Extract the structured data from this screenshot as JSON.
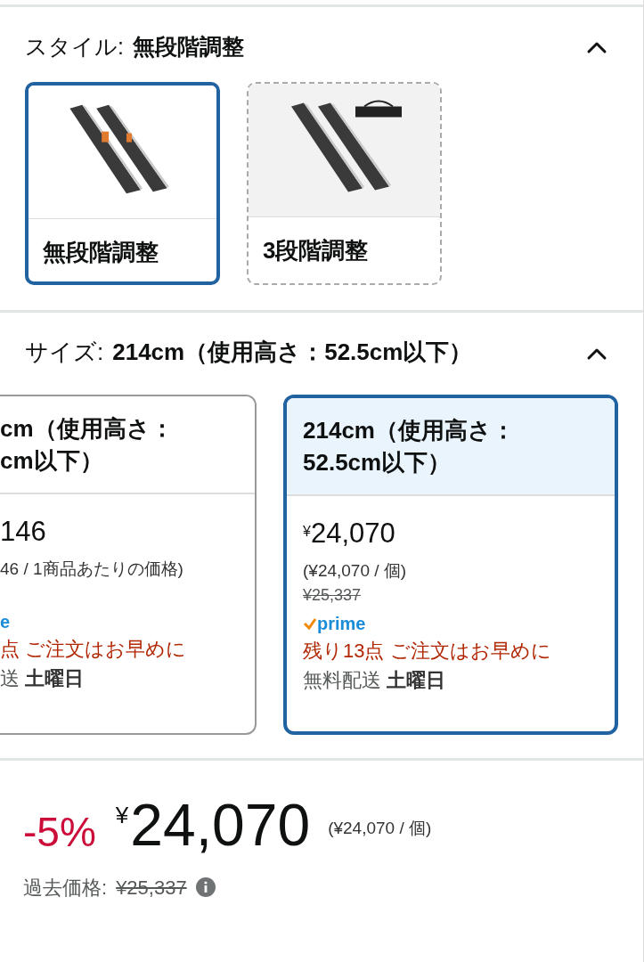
{
  "style_section": {
    "label": "スタイル:",
    "value": "無段階調整",
    "expanded": true,
    "options": [
      {
        "label": "無段階調整",
        "selected": true,
        "kind": "picture"
      },
      {
        "label": "3段階調整",
        "selected": false,
        "kind": "picture"
      }
    ]
  },
  "size_section": {
    "label": "サイズ:",
    "value": "214cm（使用高さ：52.5cm以下）",
    "expanded": true,
    "options": [
      {
        "title": "cm（使用高さ：\ncm以下）",
        "selected": false,
        "price": "146",
        "unit_price": "46 / 1商品あたりの価格)",
        "prime": "e",
        "stock": "点 ご注文はお早めに",
        "delivery": "送",
        "delivery_day": "土曜日"
      },
      {
        "title": "214cm（使用高さ：\n52.5cm以下）",
        "selected": true,
        "currency": "¥",
        "price": "24,070",
        "unit_price": "(¥24,070 / 個)",
        "list_price": "¥25,337",
        "prime": "prime",
        "stock": "残り13点 ご注文はお早めに",
        "delivery": "無料配送",
        "delivery_day": "土曜日"
      }
    ]
  },
  "price_block": {
    "discount": "-5%",
    "currency": "¥",
    "price": "24,070",
    "unit_price": "(¥24,070 / 個)",
    "past_label": "過去価格:",
    "past_price": "¥25,337"
  }
}
